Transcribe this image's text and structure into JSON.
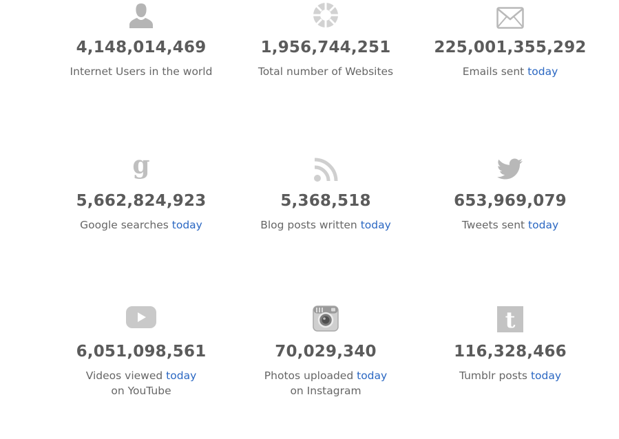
{
  "stats": [
    {
      "count": "4,148,014,469",
      "label": "Internet Users in the world",
      "today": "",
      "line2": "",
      "icon": "person-icon"
    },
    {
      "count": "1,956,744,251",
      "label": "Total number of Websites",
      "today": "",
      "line2": "",
      "icon": "globe-icon"
    },
    {
      "count": "225,001,355,292",
      "label": "Emails sent",
      "today": "today",
      "line2": "",
      "icon": "envelope-icon"
    },
    {
      "count": "5,662,824,923",
      "label": "Google searches",
      "today": "today",
      "line2": "",
      "icon": "google-g-icon"
    },
    {
      "count": "5,368,518",
      "label": "Blog posts written",
      "today": "today",
      "line2": "",
      "icon": "rss-icon"
    },
    {
      "count": "653,969,079",
      "label": "Tweets sent",
      "today": "today",
      "line2": "",
      "icon": "twitter-bird-icon"
    },
    {
      "count": "6,051,098,561",
      "label": "Videos viewed",
      "today": "today",
      "line2": "on YouTube",
      "icon": "youtube-play-icon"
    },
    {
      "count": "70,029,340",
      "label": "Photos uploaded",
      "today": "today",
      "line2": "on Instagram",
      "icon": "instagram-camera-icon"
    },
    {
      "count": "116,328,466",
      "label": "Tumblr posts",
      "today": "today",
      "line2": "",
      "icon": "tumblr-icon"
    }
  ],
  "colors": {
    "count": "#5b5b5b",
    "label": "#666666",
    "today_link": "#2a67c2",
    "icon": "#b5b5b5"
  }
}
